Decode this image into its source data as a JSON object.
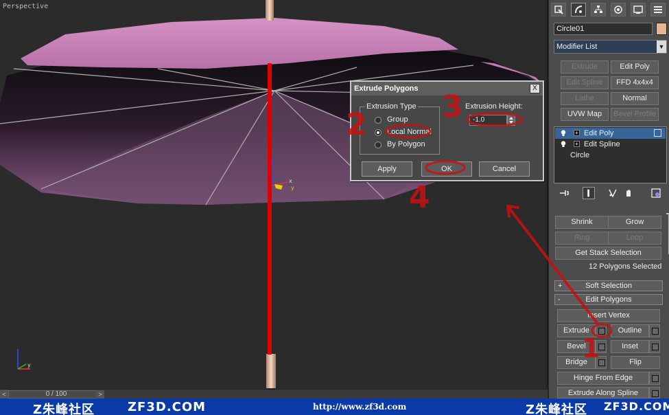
{
  "viewport": {
    "label": "Perspective"
  },
  "timeline": {
    "left_arrow": "<",
    "frame_label": "0 / 100",
    "right_arrow": ">"
  },
  "panel": {
    "object_name": "Circle01",
    "object_color": "#e6b591",
    "modifier_list": "Modifier List",
    "modifier_buttons": [
      {
        "label": "Extrude",
        "enabled": false
      },
      {
        "label": "Edit Poly",
        "enabled": true
      },
      {
        "label": "Edit Spline",
        "enabled": false
      },
      {
        "label": "FFD 4x4x4",
        "enabled": true
      },
      {
        "label": "Lathe",
        "enabled": false
      },
      {
        "label": "Normal",
        "enabled": true
      },
      {
        "label": "UVW Map",
        "enabled": true
      },
      {
        "label": "Bevel Profile",
        "enabled": false
      }
    ],
    "stack": [
      {
        "label": "Edit Poly",
        "selected": true
      },
      {
        "label": "Edit Spline",
        "selected": false
      },
      {
        "label": "Circle",
        "selected": false
      }
    ]
  },
  "selection": {
    "shrink": "Shrink",
    "grow": "Grow",
    "ring": "Ring",
    "loop": "Loop",
    "get_stack": "Get Stack Selection",
    "status": "12 Polygons Selected"
  },
  "soft_selection": {
    "sign": "+",
    "label": "Soft Selection"
  },
  "edit_polygons": {
    "sign": "-",
    "label": "Edit Polygons",
    "insert_vertex": "Insert Vertex",
    "extrude": "Extrude",
    "outline": "Outline",
    "bevel": "Bevel",
    "inset": "Inset",
    "bridge": "Bridge",
    "flip": "Flip",
    "hinge": "Hinge From Edge",
    "extrude_spline": "Extrude Along Spline"
  },
  "dialog": {
    "title": "Extrude Polygons",
    "close": "X",
    "group_label": "Extrusion Type",
    "options": [
      {
        "label": "Group",
        "checked": false
      },
      {
        "label": "Local Normal",
        "checked": true
      },
      {
        "label": "By Polygon",
        "checked": false
      }
    ],
    "height_label": "Extrusion Height:",
    "height_value": "-1.0",
    "apply": "Apply",
    "ok": "OK",
    "cancel": "Cancel"
  },
  "annotations": {
    "n1": "1",
    "n2": "2",
    "n3": "3",
    "n4": "4"
  },
  "watermark": {
    "left_cn": "Z朱峰社区",
    "left_en": "ZF3D.COM",
    "url": "http://www.zf3d.com",
    "right_cn": "Z朱峰社区",
    "right_en": "ZF3D.COM",
    "bar_color": "#0a3aa8"
  }
}
